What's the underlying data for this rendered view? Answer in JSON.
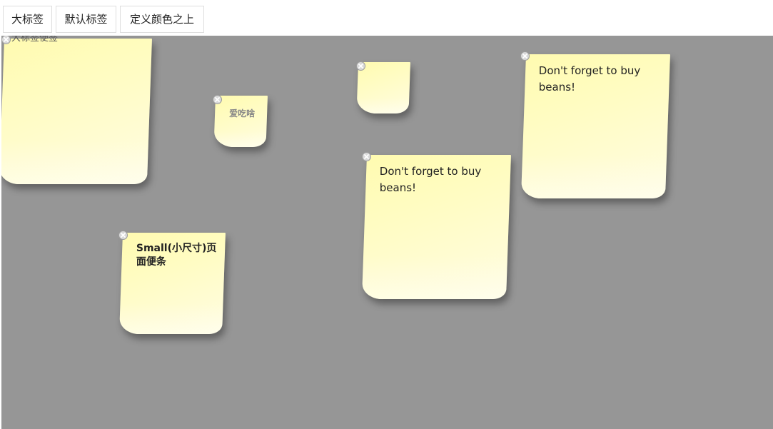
{
  "toolbar": {
    "buttons": [
      {
        "label": "大标签"
      },
      {
        "label": "默认标签"
      },
      {
        "label": "定义颜色之上"
      }
    ]
  },
  "board": {
    "background": "#969696",
    "note_color": "#fffcc0",
    "notes": [
      {
        "text": "",
        "partial_label": "大标签便签",
        "size": "large"
      },
      {
        "text": "爱吃啥",
        "size": "mini"
      },
      {
        "text": "",
        "size": "mini"
      },
      {
        "text": "Don't forget to buy beans!",
        "size": "default"
      },
      {
        "text": "Don't forget to buy beans!",
        "size": "default"
      },
      {
        "text": "Small(小尺寸)页面便条",
        "size": "small"
      }
    ],
    "close_icon": "close-circle-icon"
  }
}
